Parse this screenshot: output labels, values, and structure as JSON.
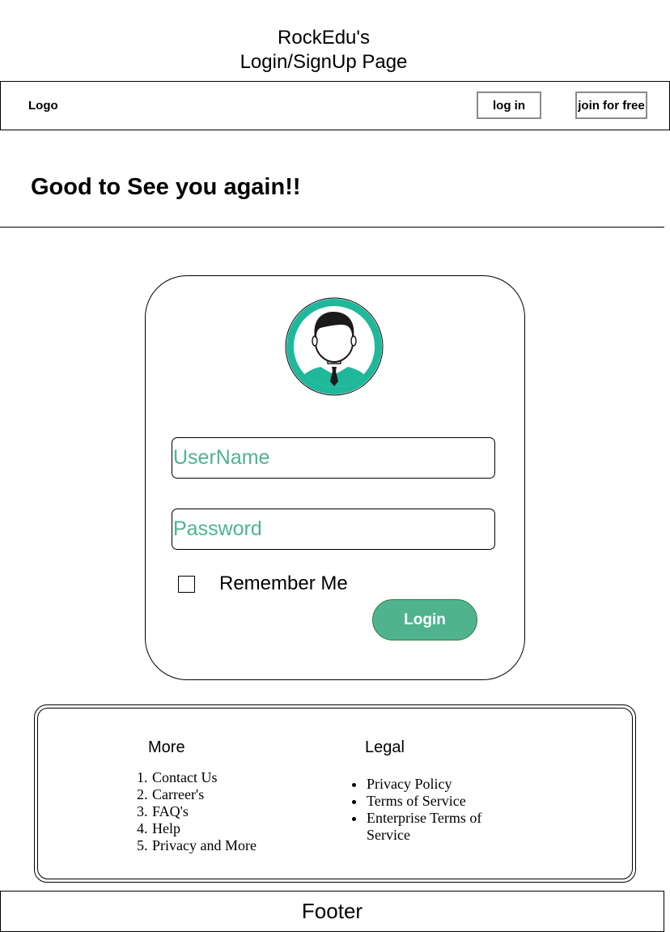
{
  "page_title": {
    "line1": "RockEdu's",
    "line2": "Login/SignUp Page"
  },
  "navbar": {
    "logo": "Logo",
    "login_label": "log in",
    "join_label": "join for free"
  },
  "welcome_heading": "Good to See you again!!",
  "login_form": {
    "avatar_icon": "user-avatar-icon",
    "username_placeholder": "UserName",
    "password_placeholder": "Password",
    "remember_label": "Remember Me",
    "remember_checked": false,
    "submit_label": "Login"
  },
  "links": {
    "more": {
      "heading": "More",
      "items": [
        "Contact Us",
        "Carreer's",
        "FAQ's",
        "Help",
        "Privacy and More"
      ]
    },
    "legal": {
      "heading": "Legal",
      "items": [
        "Privacy Policy",
        "Terms of Service",
        "Enterprise Terms of Service"
      ]
    }
  },
  "footer": "Footer",
  "colors": {
    "accent": "#4fb38f",
    "avatar": "#1fb89a",
    "login_border": "#2f7d3a"
  }
}
